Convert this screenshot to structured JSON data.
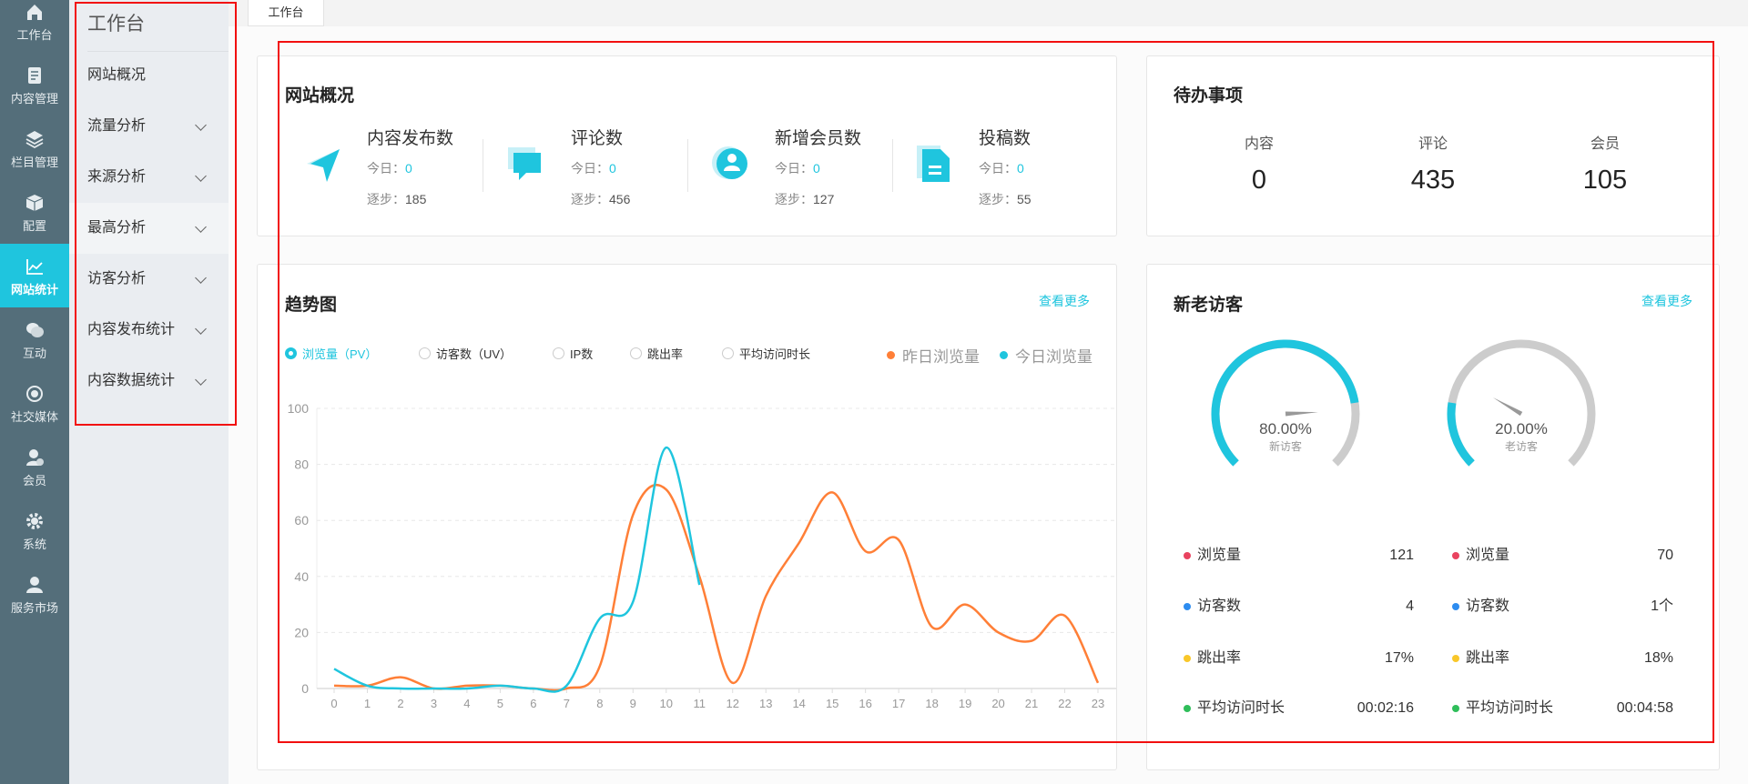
{
  "iconbar": {
    "items": [
      {
        "label": "工作台",
        "icon": "home-icon"
      },
      {
        "label": "内容管理",
        "icon": "document-icon"
      },
      {
        "label": "栏目管理",
        "icon": "layers-icon"
      },
      {
        "label": "配置",
        "icon": "cube-icon"
      },
      {
        "label": "网站统计",
        "icon": "chart-icon",
        "active": true
      },
      {
        "label": "互动",
        "icon": "chat-icon"
      },
      {
        "label": "社交媒体",
        "icon": "target-icon"
      },
      {
        "label": "会员",
        "icon": "member-icon"
      },
      {
        "label": "系统",
        "icon": "gear-icon"
      },
      {
        "label": "服务市场",
        "icon": "service-icon"
      }
    ]
  },
  "subnav": {
    "title": "工作台",
    "items": [
      {
        "label": "网站概况",
        "expandable": false
      },
      {
        "label": "流量分析",
        "expandable": true
      },
      {
        "label": "来源分析",
        "expandable": true
      },
      {
        "label": "最高分析",
        "expandable": true,
        "hover": true
      },
      {
        "label": "访客分析",
        "expandable": true
      },
      {
        "label": "内容发布统计",
        "expandable": true
      },
      {
        "label": "内容数据统计",
        "expandable": true
      }
    ]
  },
  "tabs": [
    {
      "label": "工作台"
    }
  ],
  "overview": {
    "title": "网站概况",
    "stats": [
      {
        "label": "内容发布数",
        "today_label": "今日：",
        "today": "0",
        "step_label": "逐步：",
        "step": "185",
        "icon": "send-icon"
      },
      {
        "label": "评论数",
        "today_label": "今日：",
        "today": "0",
        "step_label": "逐步：",
        "step": "456",
        "icon": "comment-icon"
      },
      {
        "label": "新增会员数",
        "today_label": "今日：",
        "today": "0",
        "step_label": "逐步：",
        "step": "127",
        "icon": "user-icon"
      },
      {
        "label": "投稿数",
        "today_label": "今日：",
        "today": "0",
        "step_label": "逐步：",
        "step": "55",
        "icon": "file-icon"
      }
    ]
  },
  "todo": {
    "title": "待办事项",
    "items": [
      {
        "label": "内容",
        "value": "0"
      },
      {
        "label": "评论",
        "value": "435"
      },
      {
        "label": "会员",
        "value": "105"
      }
    ]
  },
  "trend": {
    "title": "趋势图",
    "more": "查看更多",
    "radios": [
      {
        "label": "浏览量（PV）",
        "selected": true
      },
      {
        "label": "访客数（UV）",
        "selected": false
      },
      {
        "label": "IP数",
        "selected": false
      },
      {
        "label": "跳出率",
        "selected": false
      },
      {
        "label": "平均访问时长",
        "selected": false
      }
    ]
  },
  "chart_data": {
    "type": "line",
    "x": [
      "0",
      "1",
      "2",
      "3",
      "4",
      "5",
      "6",
      "7",
      "8",
      "9",
      "10",
      "11",
      "12",
      "13",
      "14",
      "15",
      "16",
      "17",
      "18",
      "19",
      "20",
      "21",
      "22",
      "23"
    ],
    "ylim": [
      0,
      100
    ],
    "yticks": [
      "0",
      "20",
      "40",
      "60",
      "80",
      "100"
    ],
    "grid": true,
    "legend_position": "top-right",
    "series": [
      {
        "name": "昨日浏览量",
        "color": "#ff7f37",
        "values": [
          1,
          1,
          4,
          0,
          1,
          1,
          0,
          0,
          8,
          62,
          71,
          40,
          2,
          33,
          52,
          70,
          49,
          53,
          22,
          30,
          20,
          17,
          26,
          2
        ]
      },
      {
        "name": "今日浏览量",
        "color": "#1fc5de",
        "values": [
          7,
          1,
          0,
          0,
          0,
          1,
          0,
          1,
          25,
          31,
          86,
          37
        ]
      }
    ]
  },
  "visitors": {
    "title": "新老访客",
    "more": "查看更多",
    "gauges": [
      {
        "value": 0.8,
        "text": "80.00%",
        "label": "新访客"
      },
      {
        "value": 0.2,
        "text": "20.00%",
        "label": "老访客"
      }
    ],
    "columns": [
      [
        {
          "label": "浏览量",
          "value": "121",
          "color": "#e9435f"
        },
        {
          "label": "访客数",
          "value": "4",
          "color": "#2d8cf0"
        },
        {
          "label": "跳出率",
          "value": "17%",
          "color": "#f9c72a"
        },
        {
          "label": "平均访问时长",
          "value": "00:02:16",
          "color": "#2fbe5a"
        }
      ],
      [
        {
          "label": "浏览量",
          "value": "70",
          "color": "#e9435f"
        },
        {
          "label": "访客数",
          "value": "1个",
          "color": "#2d8cf0"
        },
        {
          "label": "跳出率",
          "value": "18%",
          "color": "#f9c72a"
        },
        {
          "label": "平均访问时长",
          "value": "00:04:58",
          "color": "#2fbe5a"
        }
      ]
    ]
  },
  "colors": {
    "accent": "#1fc5de",
    "sidebar": "#546e7a",
    "orange": "#ff7f37",
    "annotation": "#f20f0f"
  }
}
